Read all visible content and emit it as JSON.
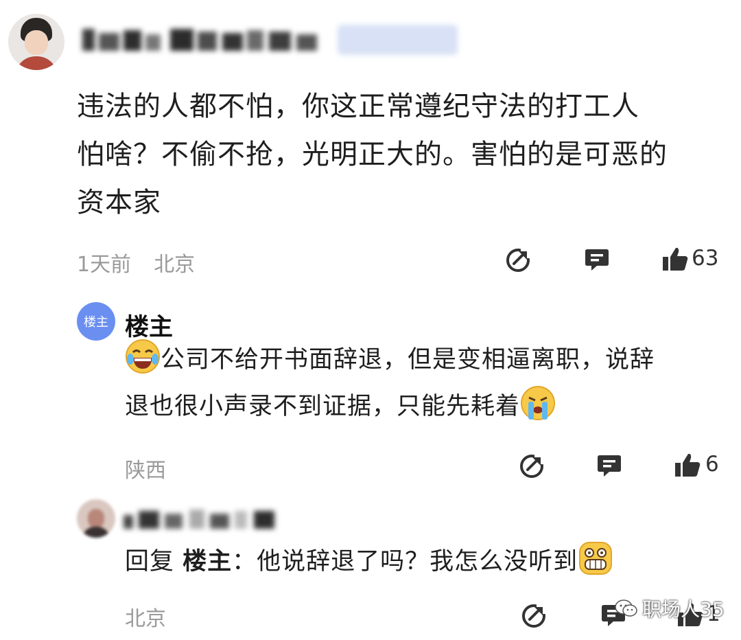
{
  "comment1": {
    "text_line1": "违法的人都不怕，你这正常遵纪守法的打工人",
    "text_line2": "怕啥？不偷不抢，光明正大的。害怕的是可恶的",
    "text_line3": "资本家",
    "time": "1天前",
    "location": "北京",
    "like_count": "63"
  },
  "reply1": {
    "avatar_label": "楼主",
    "author": "楼主",
    "text_line1": "公司不给开书面辞退，但是变相逼离职，说辞",
    "text_line2": "退也很小声录不到证据，只能先耗着",
    "location": "陕西",
    "like_count": "6"
  },
  "reply2": {
    "reply_prefix": "回复",
    "reply_to": "楼主",
    "text": "：他说辞退了吗？我怎么没听到",
    "location": "北京",
    "like_count": "1"
  },
  "watermark": "职场人35",
  "icons": [
    "share-icon",
    "comment-icon",
    "thumbs-up-icon",
    "laughing-tears-emoji",
    "crying-emoji",
    "grinning-emoji",
    "wechat-logo-icon"
  ]
}
